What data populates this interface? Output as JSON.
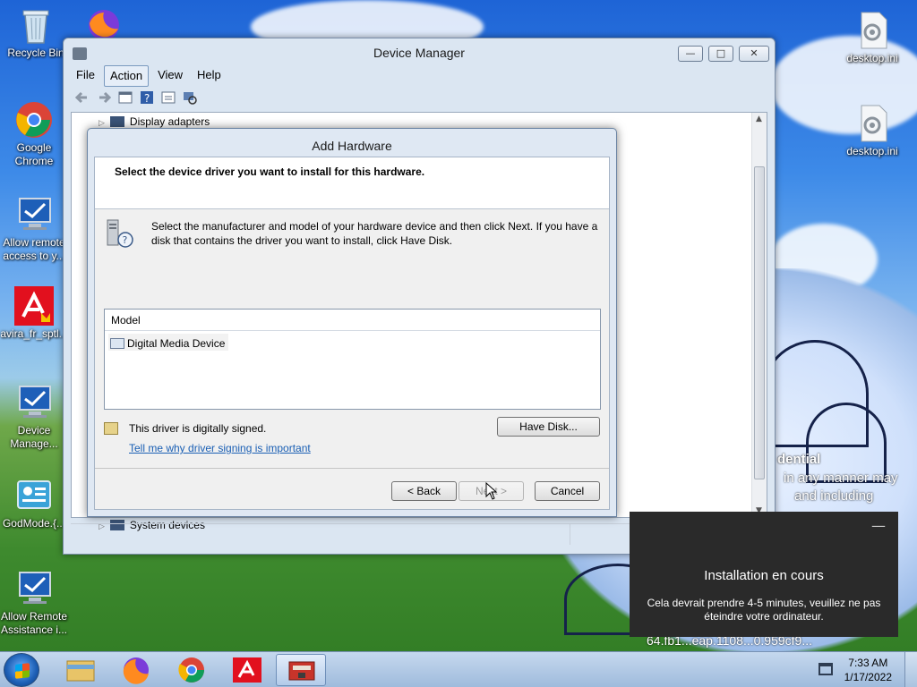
{
  "desktop": {
    "icons_left": [
      {
        "label": "Recycle Bin"
      },
      {
        "label": "Google Chrome"
      },
      {
        "label": "Allow remote access to y..."
      },
      {
        "label": "avira_fr_sptl..."
      },
      {
        "label": "Device Manage..."
      },
      {
        "label": "GodMode.{..."
      },
      {
        "label": "Allow Remote Assistance i..."
      }
    ],
    "icons_right": [
      {
        "label": "desktop.ini"
      },
      {
        "label": "desktop.ini"
      }
    ],
    "background_text": {
      "line1": "dential",
      "line2": "in any manner may",
      "line3": "and including",
      "line4": "64.fb1...eap.1108...0.959cf9..."
    }
  },
  "device_manager": {
    "title": "Device Manager",
    "window_buttons": {
      "minimize": "—",
      "maximize": "□",
      "close": "✕"
    },
    "menu": [
      "File",
      "Action",
      "View",
      "Help"
    ],
    "active_menu": "Action",
    "tree": {
      "top_item": "Display adapters",
      "bottom_item": "System devices"
    }
  },
  "add_hardware": {
    "title": "Add Hardware",
    "header": "Select the device driver you want to install for this hardware.",
    "instructions": "Select the manufacturer and model of your hardware device and then click Next. If you have a disk that contains the driver you want to install, click Have Disk.",
    "model_column": "Model",
    "models": [
      "Digital Media Device"
    ],
    "signed_text": "This driver is digitally signed.",
    "signing_link": "Tell me why driver signing is important",
    "buttons": {
      "have_disk": "Have Disk...",
      "back": "< Back",
      "next": "Next >",
      "cancel": "Cancel"
    }
  },
  "notification": {
    "title": "Installation en cours",
    "message": "Cela devrait prendre 4-5 minutes, veuillez ne pas éteindre votre ordinateur."
  },
  "taskbar": {
    "time": "7:33 AM",
    "date": "1/17/2022",
    "apps": [
      "file-explorer-icon",
      "firefox-icon",
      "chrome-icon",
      "avira-icon",
      "add-hardware-icon"
    ]
  },
  "colors": {
    "link": "#1a5fb4",
    "dialog_frame": "#dfe8f3",
    "notification_bg": "#2a2a2a"
  }
}
